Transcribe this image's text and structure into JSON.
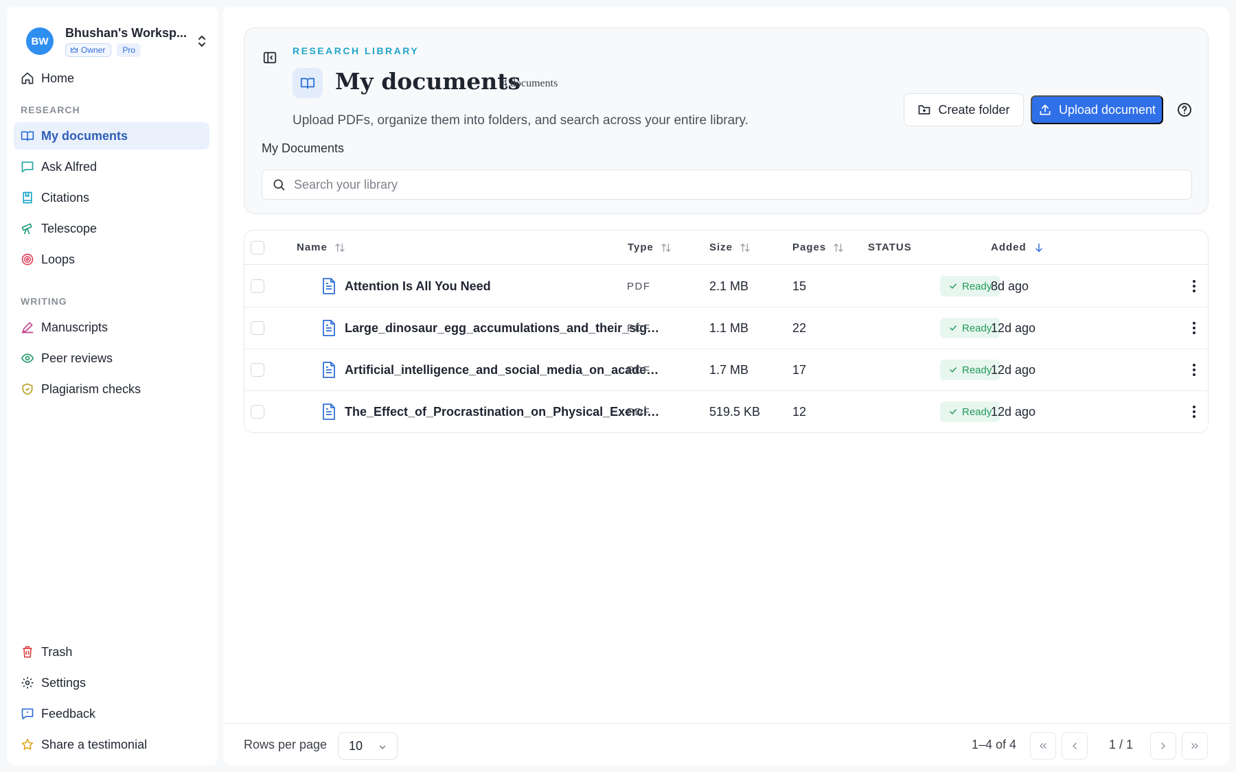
{
  "workspace": {
    "initials": "BW",
    "name": "Bhushan's Worksp...",
    "role_badge": "Owner",
    "plan_badge": "Pro"
  },
  "sidebar": {
    "home": "Home",
    "research_heading": "RESEARCH",
    "research_items": [
      "My documents",
      "Ask Alfred",
      "Citations",
      "Telescope",
      "Loops"
    ],
    "writing_heading": "WRITING",
    "writing_items": [
      "Manuscripts",
      "Peer reviews",
      "Plagiarism checks"
    ],
    "bottom_items": [
      "Trash",
      "Settings",
      "Feedback",
      "Share a testimonial"
    ]
  },
  "header": {
    "kicker": "RESEARCH LIBRARY",
    "title": "My documents",
    "count": "4 documents",
    "subtitle": "Upload PDFs, organize them into folders, and search across your entire library.",
    "create_folder": "Create folder",
    "upload": "Upload document",
    "breadcrumb": "My Documents",
    "search_placeholder": "Search your library"
  },
  "table": {
    "columns": {
      "name": "Name",
      "type": "Type",
      "size": "Size",
      "pages": "Pages",
      "status": "STATUS",
      "added": "Added"
    },
    "rows": [
      {
        "name": "Attention Is All You Need",
        "type": "PDF",
        "size": "2.1 MB",
        "pages": "15",
        "status": "Ready",
        "added": "8d ago"
      },
      {
        "name": "Large_dinosaur_egg_accumulations_and_their_signifi...",
        "type": "PDF",
        "size": "1.1 MB",
        "pages": "22",
        "status": "Ready",
        "added": "12d ago"
      },
      {
        "name": "Artificial_intelligence_and_social_media_on_academi...",
        "type": "PDF",
        "size": "1.7 MB",
        "pages": "17",
        "status": "Ready",
        "added": "12d ago"
      },
      {
        "name": "The_Effect_of_Procrastination_on_Physical_Exercise_...",
        "type": "PDF",
        "size": "519.5 KB",
        "pages": "12",
        "status": "Ready",
        "added": "12d ago"
      }
    ]
  },
  "footer": {
    "rows_per_page_label": "Rows per page",
    "rows_per_page_value": "10",
    "range": "1–4 of 4",
    "page": "1 / 1"
  },
  "colors": {
    "accent": "#2f6fe8",
    "kicker": "#1fa6c9",
    "ready_bg": "#e7f6ee",
    "ready_text": "#23995a"
  }
}
